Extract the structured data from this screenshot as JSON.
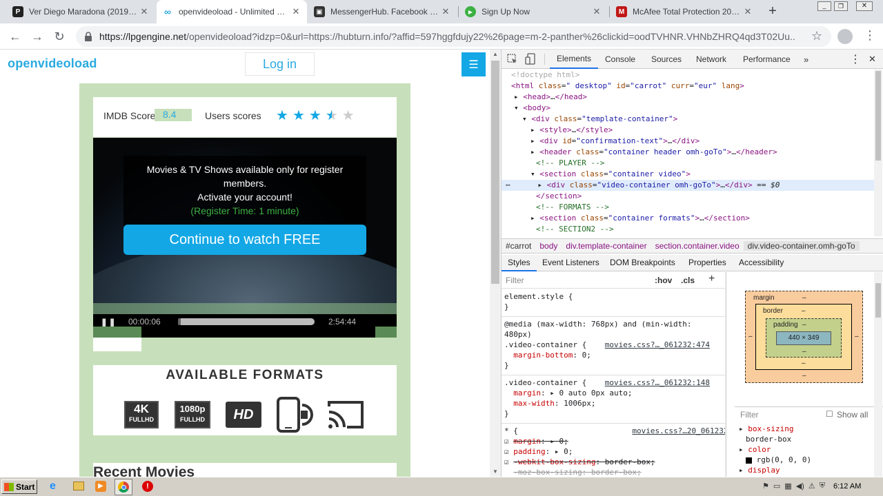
{
  "tabs": [
    {
      "title": "Ver Diego Maradona (2019) Onli",
      "favicon": "P"
    },
    {
      "title": "openvideoload - Unlimited Movie",
      "favicon": "∞"
    },
    {
      "title": "MessengerHub. Facebook Messe",
      "favicon": "▣"
    },
    {
      "title": "Sign Up Now",
      "favicon": "▶"
    },
    {
      "title": "McAfee Total Protection 2020 |",
      "favicon": "M"
    }
  ],
  "address": {
    "host": "https://lpgengine.net",
    "path": "/openvideoload?idzp=0&url=https://hubturn.info/?affid=597hggfdujy22%26page=m-2-panther%26clickid=oodTVHNR.VHNbZHRQ4qd3T02Uu..."
  },
  "site": {
    "logo": "openvideoload",
    "login": "Log in",
    "imdb_label": "IMDB Score",
    "imdb_value": "8.4",
    "users_scores": "Users scores",
    "rating": 3.5,
    "overlay_line1": "Movies & TV Shows available only for register members.",
    "overlay_line2": "Activate your account!",
    "overlay_line3": "(Register Time: 1 minute)",
    "cta": "Continue to watch FREE",
    "time_current": "00:00:06",
    "time_total": "2:54:44",
    "progress": 0.02,
    "formats_title": "AVAILABLE FORMATS",
    "formats": [
      "4K",
      "1080p",
      "HD"
    ],
    "format_sub": "FULLHD",
    "recent_title": "Recent Movies"
  },
  "devtools": {
    "tabs": [
      "Elements",
      "Console",
      "Sources",
      "Network",
      "Performance"
    ],
    "breadcrumb": [
      "#carrot",
      "body",
      "div.template-container",
      "section.container.video",
      "div.video-container.omh-goTo"
    ],
    "subtabs": [
      "Styles",
      "Event Listeners",
      "DOM Breakpoints",
      "Properties",
      "Accessibility"
    ],
    "filter_placeholder": "Filter",
    "hov": ":hov",
    "cls": ".cls",
    "box_margin": "margin",
    "box_border": "border",
    "box_padding": "padding",
    "box_dash": "–",
    "box_size": "440 × 349",
    "filter2": "Filter",
    "show_all": "Show all",
    "computed": [
      "box-sizing",
      "border-box",
      "color",
      "rgb(0, 0, 0)",
      "display"
    ]
  },
  "taskbar": {
    "start": "Start",
    "clock": "6:12 AM"
  }
}
